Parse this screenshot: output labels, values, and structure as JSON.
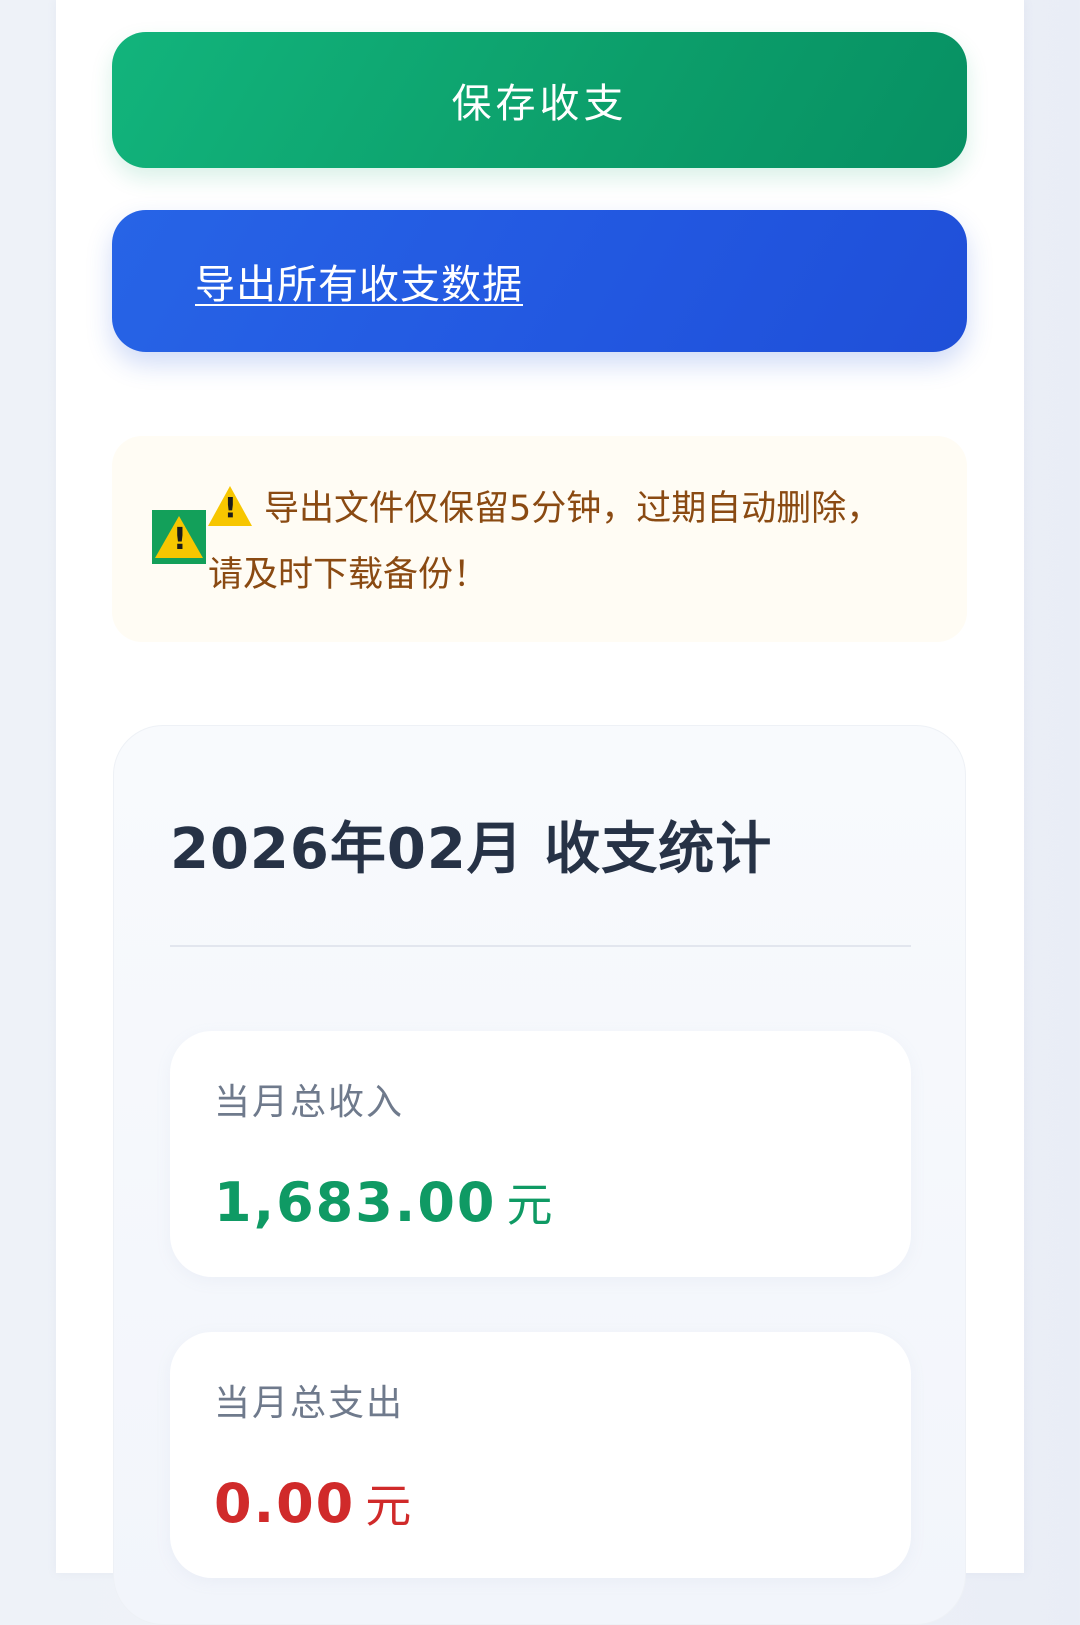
{
  "actions": {
    "save_label": "保存收支",
    "export_label": "导出所有收支数据"
  },
  "notice": {
    "icon": "warning-icon",
    "text": "导出文件仅保留5分钟，过期自动删除，请及时下载备份！"
  },
  "stats": {
    "title": "2026年02月 收支统计",
    "income_label": "当月总收入",
    "income_value": "1,683.00",
    "income_unit": "元",
    "expense_label": "当月总支出",
    "expense_value": "0.00",
    "expense_unit": "元"
  },
  "colors": {
    "save_button": "#0fa872",
    "export_button": "#2359e0",
    "notice_text": "#8a4a12",
    "income": "#0f9a64",
    "expense": "#d02a2a"
  }
}
